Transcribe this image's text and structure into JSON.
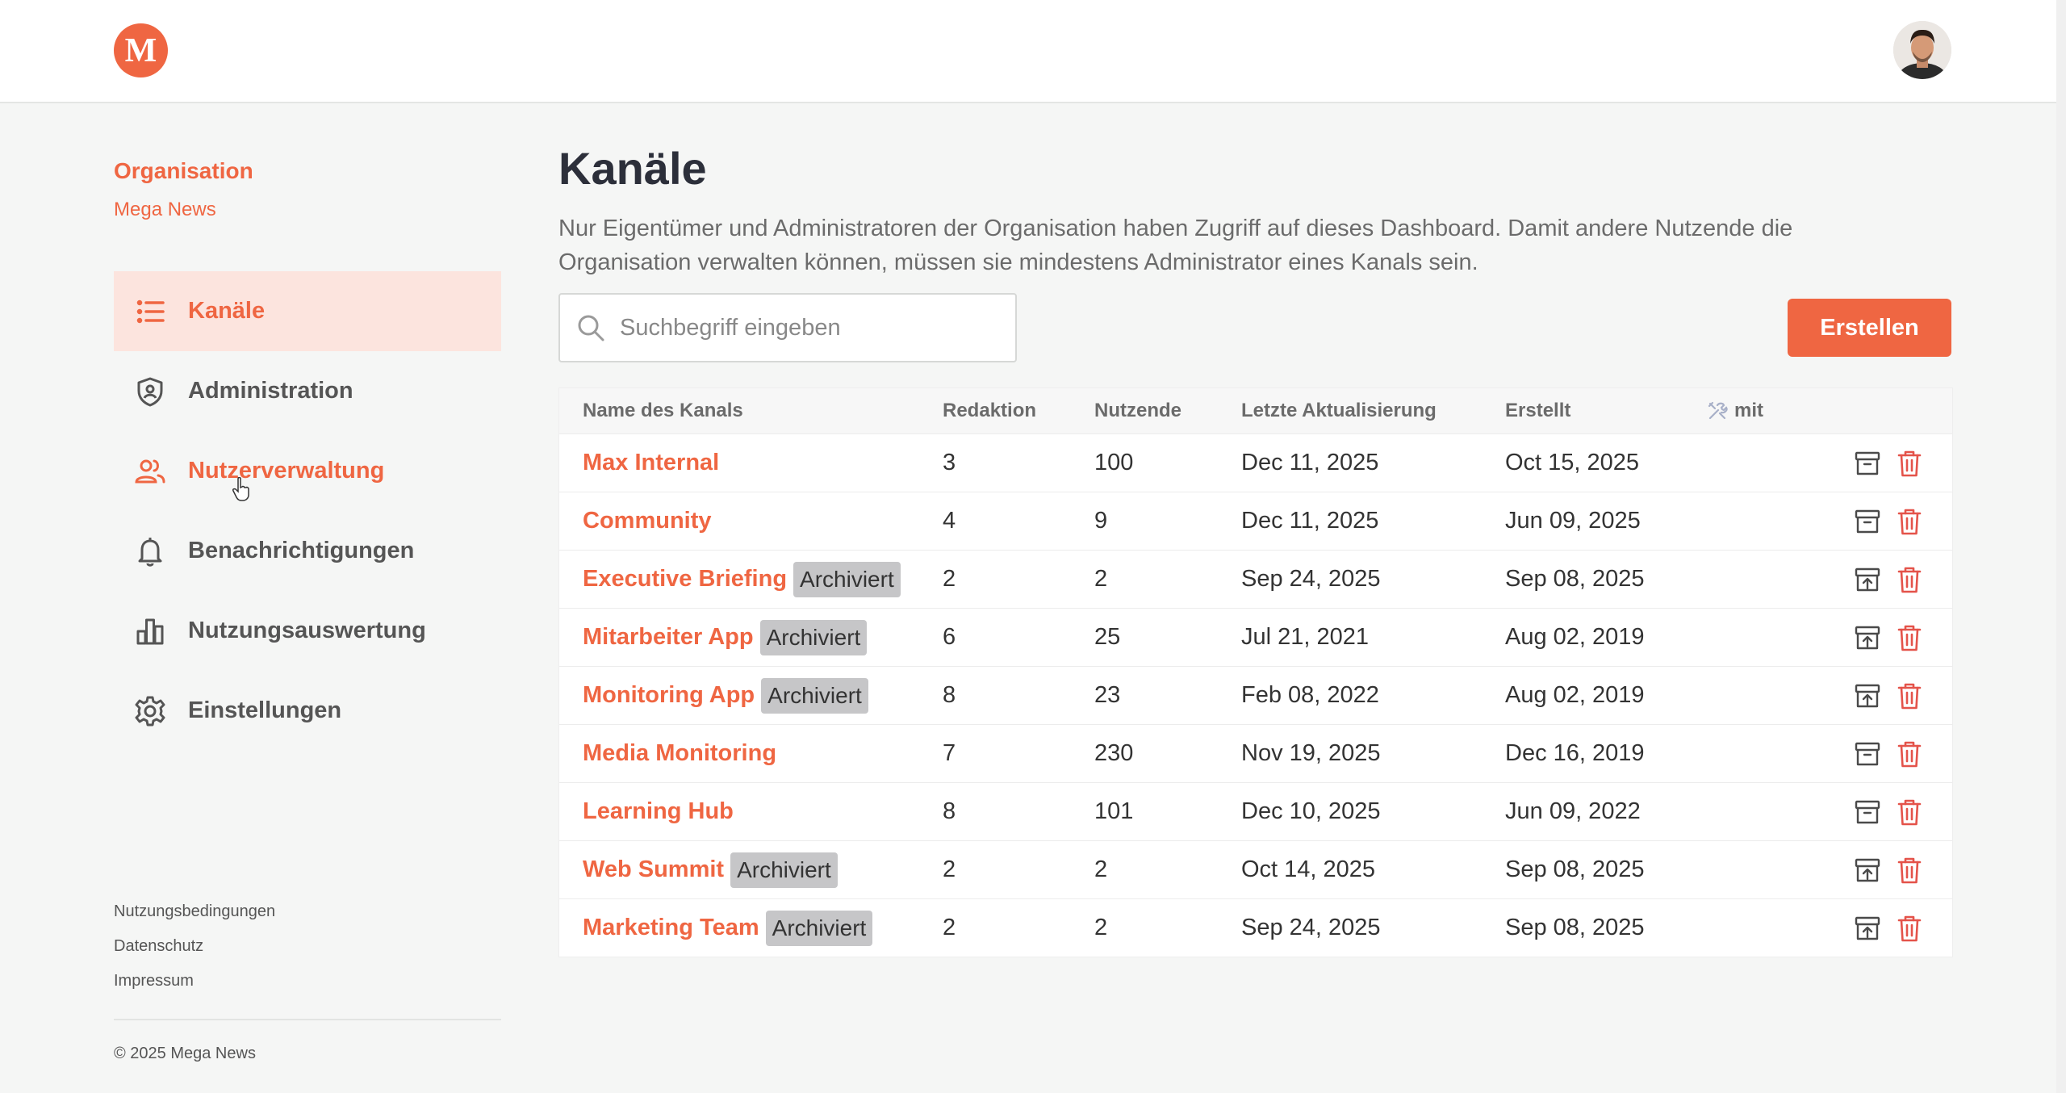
{
  "header": {
    "logo_letter": "M"
  },
  "sidebar": {
    "org_heading": "Organisation",
    "org_name": "Mega News",
    "items": [
      {
        "label": "Kanäle",
        "icon": "list-icon"
      },
      {
        "label": "Administration",
        "icon": "shield-icon"
      },
      {
        "label": "Nutzerverwaltung",
        "icon": "users-icon"
      },
      {
        "label": "Benachrichtigungen",
        "icon": "bell-icon"
      },
      {
        "label": "Nutzungsauswertung",
        "icon": "bar-chart-icon"
      },
      {
        "label": "Einstellungen",
        "icon": "gear-icon"
      }
    ],
    "footer_links": [
      "Nutzungsbedingungen",
      "Datenschutz",
      "Impressum"
    ],
    "copyright": "© 2025 Mega News"
  },
  "main": {
    "title": "Kanäle",
    "description": "Nur Eigentümer und Administratoren der Organisation haben Zugriff auf dieses Dashboard. Damit andere Nutzende die Organisation verwalten können, müssen sie mindestens Administrator eines Kanals sein.",
    "search_placeholder": "Suchbegriff eingeben",
    "create_label": "Erstellen"
  },
  "table": {
    "columns": {
      "name": "Name des Kanals",
      "redaktion": "Redaktion",
      "nutzende": "Nutzende",
      "updated": "Letzte Aktualisierung",
      "created": "Erstellt",
      "mit": "mit"
    },
    "archived_label": "Archiviert",
    "rows": [
      {
        "name": "Max Internal",
        "archived": false,
        "redaktion": "3",
        "nutzende": "100",
        "updated": "Dec 11, 2025",
        "created": "Oct 15, 2025"
      },
      {
        "name": "Community",
        "archived": false,
        "redaktion": "4",
        "nutzende": "9",
        "updated": "Dec 11, 2025",
        "created": "Jun 09, 2025"
      },
      {
        "name": "Executive Briefing",
        "archived": true,
        "redaktion": "2",
        "nutzende": "2",
        "updated": "Sep 24, 2025",
        "created": "Sep 08, 2025"
      },
      {
        "name": "Mitarbeiter App",
        "archived": true,
        "redaktion": "6",
        "nutzende": "25",
        "updated": "Jul 21, 2021",
        "created": "Aug 02, 2019"
      },
      {
        "name": "Monitoring App",
        "archived": true,
        "redaktion": "8",
        "nutzende": "23",
        "updated": "Feb 08, 2022",
        "created": "Aug 02, 2019"
      },
      {
        "name": "Media Monitoring",
        "archived": false,
        "redaktion": "7",
        "nutzende": "230",
        "updated": "Nov 19, 2025",
        "created": "Dec 16, 2019"
      },
      {
        "name": "Learning Hub",
        "archived": false,
        "redaktion": "8",
        "nutzende": "101",
        "updated": "Dec 10, 2025",
        "created": "Jun 09, 2022"
      },
      {
        "name": "Web Summit",
        "archived": true,
        "redaktion": "2",
        "nutzende": "2",
        "updated": "Oct 14, 2025",
        "created": "Sep 08, 2025"
      },
      {
        "name": "Marketing Team",
        "archived": true,
        "redaktion": "2",
        "nutzende": "2",
        "updated": "Sep 24, 2025",
        "created": "Sep 08, 2025"
      }
    ]
  },
  "colors": {
    "accent": "#ef6642",
    "active_bg": "#fce4de",
    "badge_bg": "#c6c6c8",
    "delete": "#e4534a"
  }
}
